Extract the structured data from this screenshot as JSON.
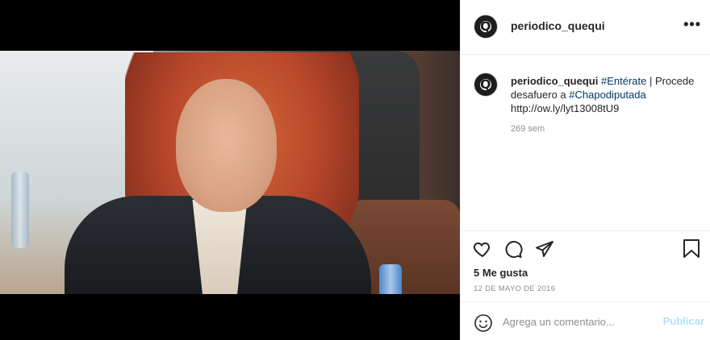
{
  "header": {
    "username": "periodico_quequi",
    "more_label": "•••"
  },
  "caption": {
    "username": "periodico_quequi",
    "tag1": "#Entérate",
    "text1": " | Procede desafuero a ",
    "tag2": "#Chapodiputada",
    "link": "http://ow.ly/lyt13008tU9",
    "time": "269 sem"
  },
  "actions": {
    "likes": "5 Me gusta",
    "date": "12 DE MAYO DE 2016"
  },
  "comment_box": {
    "placeholder": "Agrega un comentario...",
    "publish_label": "Publicar"
  },
  "colors": {
    "link": "#00376b",
    "publish": "#b2dffc",
    "muted": "#8e8e8e"
  }
}
